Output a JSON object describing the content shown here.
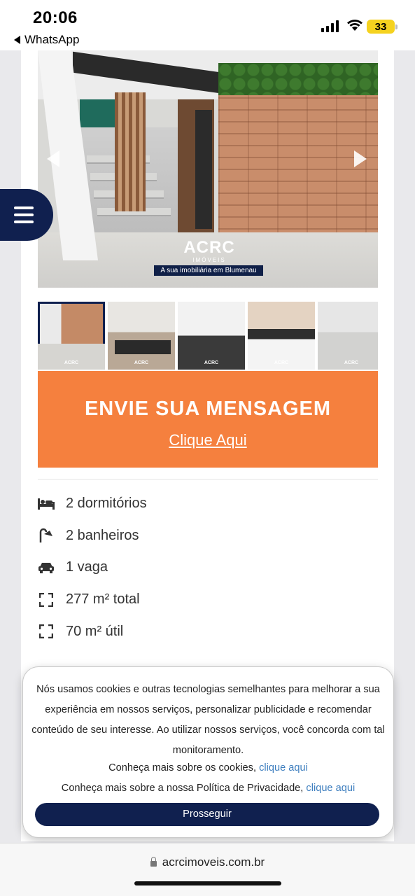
{
  "status_bar": {
    "time": "20:06",
    "back_app": "WhatsApp",
    "battery": "33"
  },
  "gallery": {
    "watermark_logo": "ACRC",
    "watermark_sub": "IMÓVEIS",
    "watermark_tagline": "A sua imobiliária em Blumenau",
    "thumb_watermark": "ACRC"
  },
  "cta": {
    "title": "ENVIE SUA MENSAGEM",
    "link": "Clique Aqui"
  },
  "features": [
    {
      "icon": "bed-icon",
      "label": "2 dormitórios"
    },
    {
      "icon": "shower-icon",
      "label": "2 banheiros"
    },
    {
      "icon": "car-icon",
      "label": "1 vaga"
    },
    {
      "icon": "area-icon",
      "label": "277 m² total"
    },
    {
      "icon": "area-icon",
      "label": "70 m² útil"
    }
  ],
  "cookie": {
    "text": "Nós usamos cookies e outras tecnologias semelhantes para melhorar a sua experiência em nossos serviços, personalizar publicidade e recomendar conteúdo de seu interesse. Ao utilizar nossos serviços, você concorda com tal monitoramento.",
    "cookies_prefix": "Conheça mais sobre os cookies,",
    "cookies_link": "clique aqui",
    "privacy_prefix": "Conheça mais sobre a nossa Política de Privacidade,",
    "privacy_link": "clique aqui",
    "button": "Prosseguir"
  },
  "browser": {
    "url": "acrcimoveis.com.br"
  },
  "colors": {
    "navy": "#10204f",
    "orange": "#f5803e",
    "link": "#3f7fbf"
  }
}
